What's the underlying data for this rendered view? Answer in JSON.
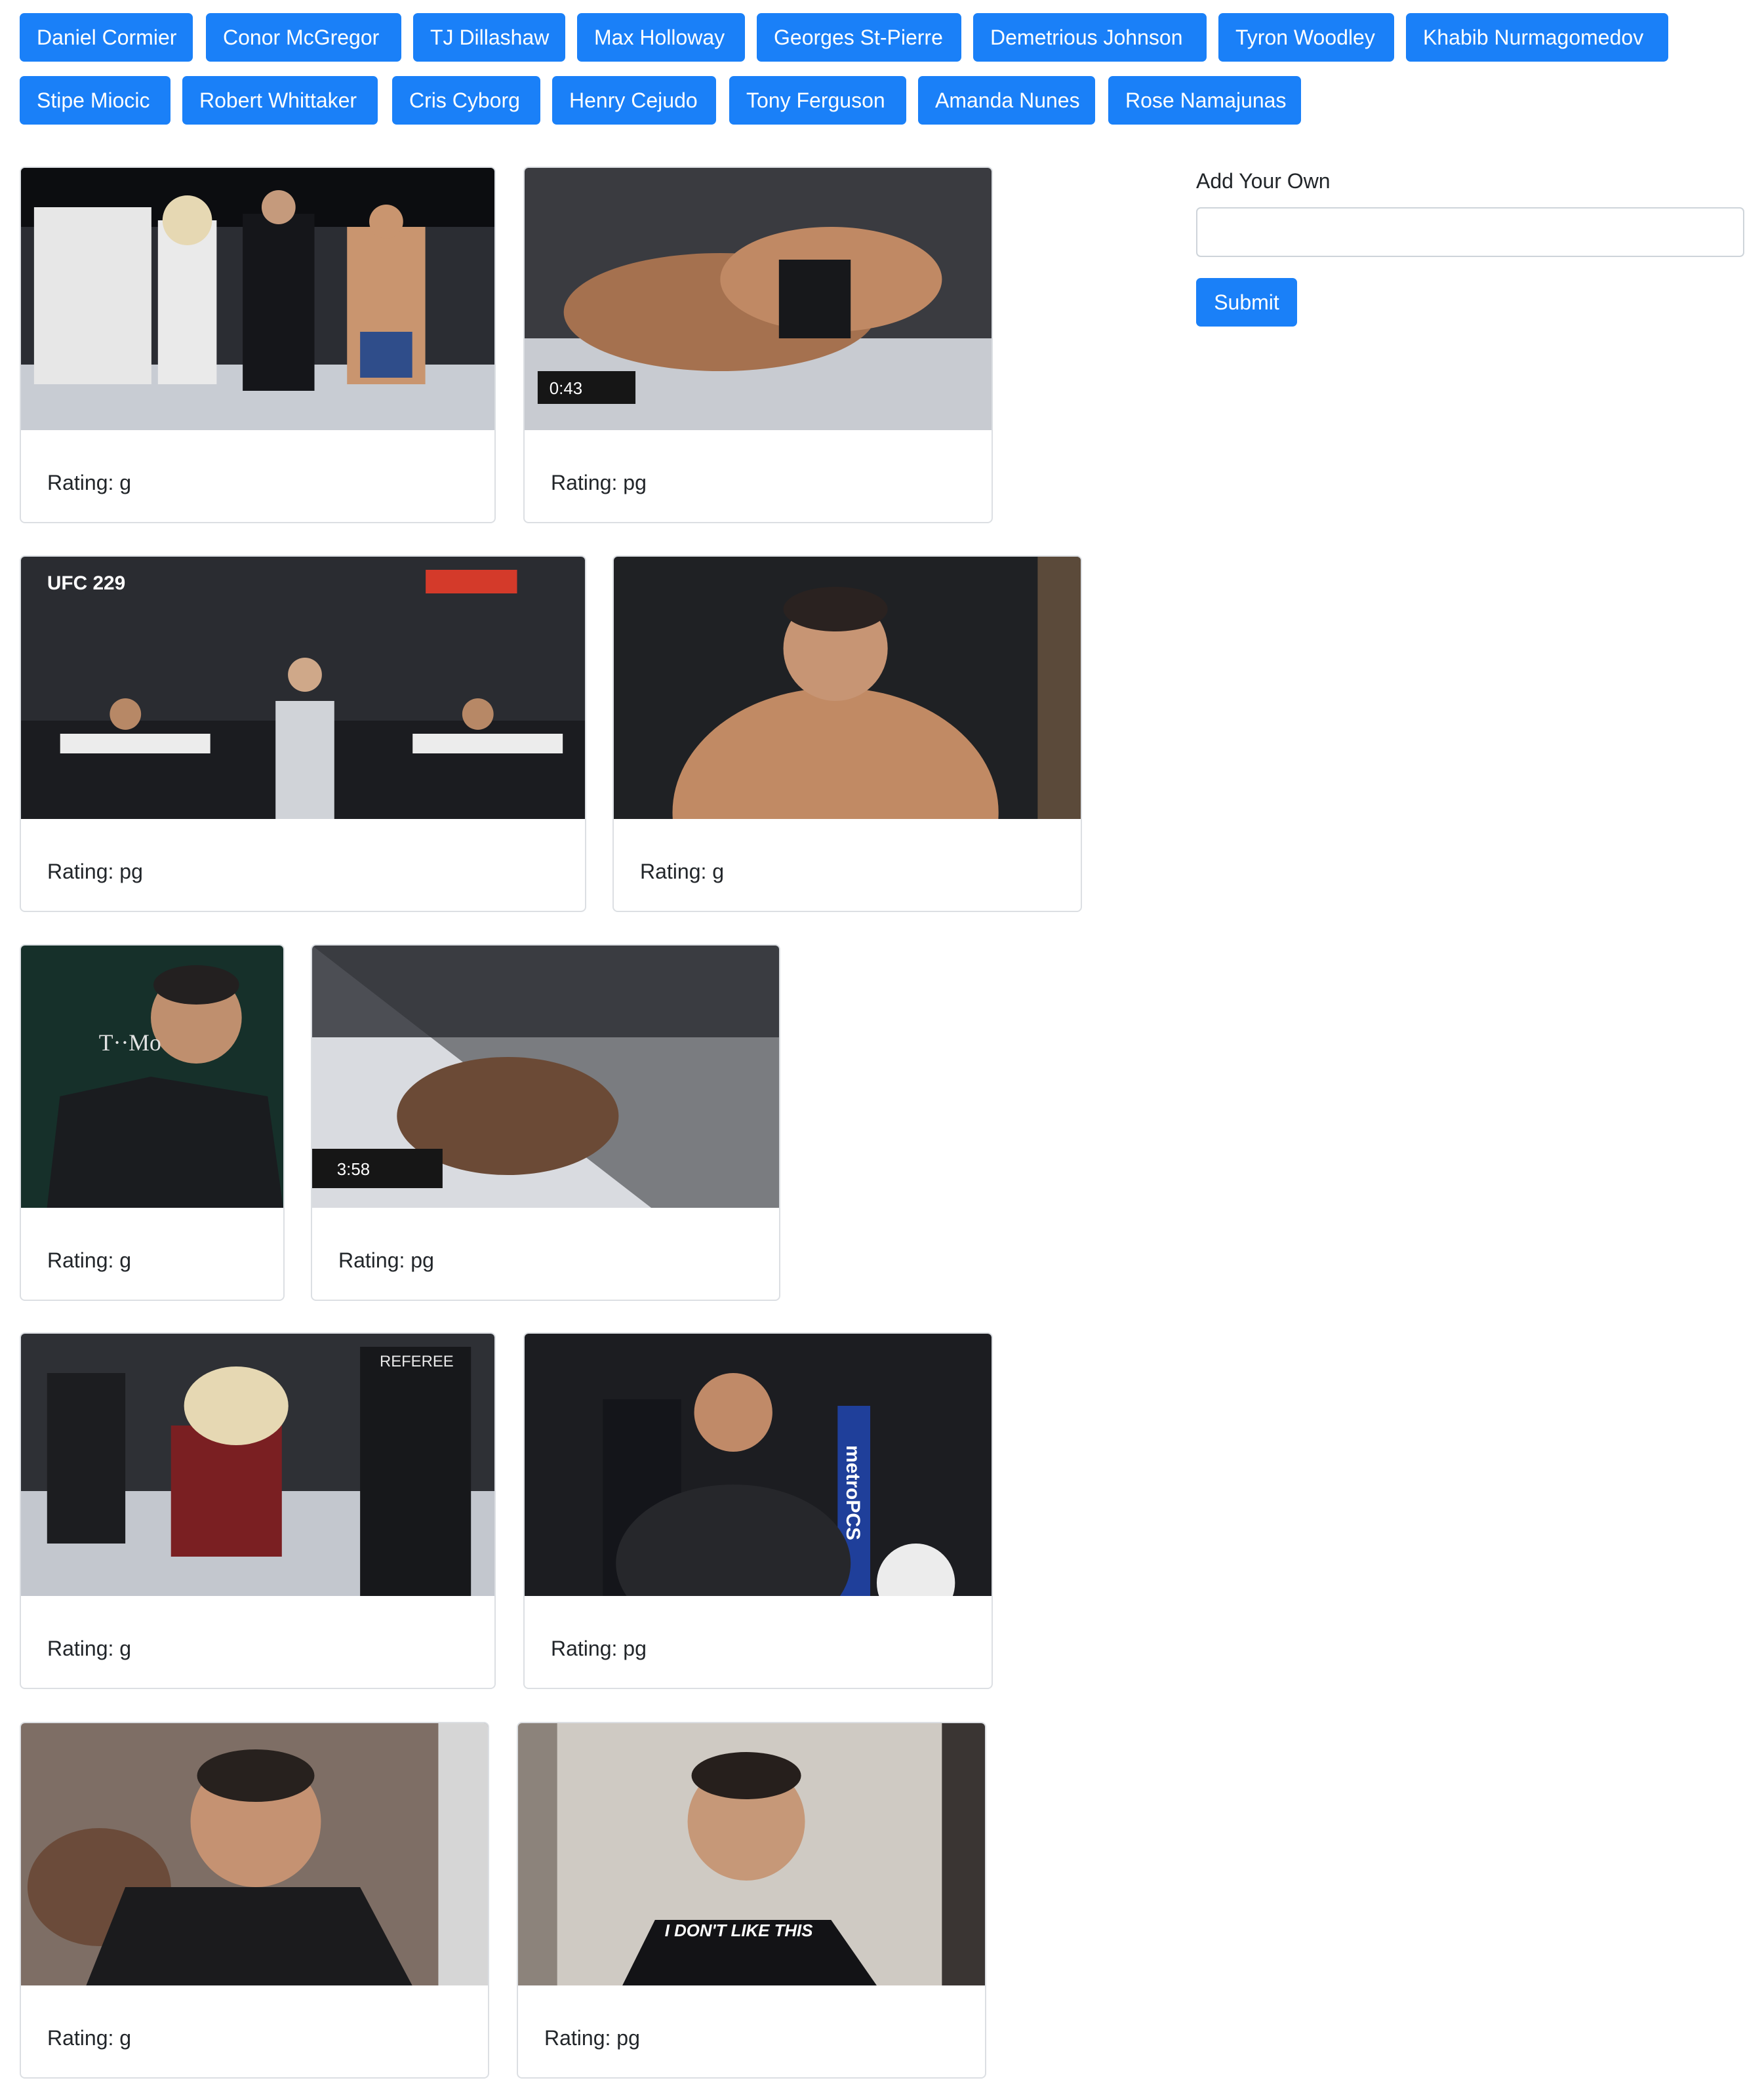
{
  "topics": [
    "Daniel Cormier",
    "Conor McGregor",
    "TJ Dillashaw",
    "Max Holloway",
    "Georges St-Pierre",
    "Demetrious Johnson",
    "Tyron Woodley",
    "Khabib Nurmagomedov",
    "Stipe Miocic",
    "Robert Whittaker",
    "Cris Cyborg",
    "Henry Cejudo",
    "Tony Ferguson",
    "Amanda Nunes",
    "Rose Namajunas"
  ],
  "form": {
    "label": "Add Your Own",
    "input_value": "",
    "submit_label": "Submit"
  },
  "gifs": [
    {
      "rating": "Rating: g",
      "overlay": ""
    },
    {
      "rating": "Rating: pg",
      "overlay": "0:43"
    },
    {
      "rating": "Rating: pg",
      "overlay": "UFC 229"
    },
    {
      "rating": "Rating: g",
      "overlay": ""
    },
    {
      "rating": "Rating: g",
      "overlay": "T··Mo"
    },
    {
      "rating": "Rating: pg",
      "overlay": "3:58"
    },
    {
      "rating": "Rating: g",
      "overlay": "REFEREE"
    },
    {
      "rating": "Rating: pg",
      "overlay": "metroPCS"
    },
    {
      "rating": "Rating: g",
      "overlay": ""
    },
    {
      "rating": "Rating: pg",
      "overlay": "I DON'T LIKE THIS"
    }
  ],
  "colors": {
    "primary": "#1a80f8",
    "border": "#dcdfe3",
    "text": "#212529"
  }
}
